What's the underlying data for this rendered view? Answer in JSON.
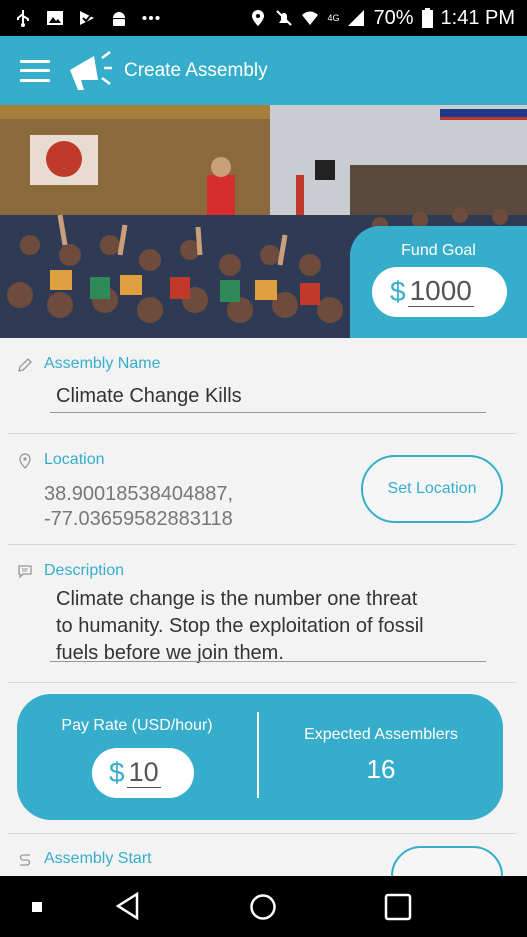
{
  "status_bar": {
    "network": "4G",
    "battery": "70%",
    "time": "1:41 PM"
  },
  "app_bar": {
    "title": "Create Assembly"
  },
  "fund_goal": {
    "label": "Fund Goal",
    "currency": "$",
    "value": "1000"
  },
  "assembly_name": {
    "label": "Assembly Name",
    "value": "Climate Change Kills"
  },
  "location": {
    "label": "Location",
    "coords_line1": "38.90018538404887,",
    "coords_line2": "-77.03659582883118",
    "button_label": "Set Location"
  },
  "description": {
    "label": "Description",
    "line1": "Climate change is the number one threat",
    "line2": "to humanity. Stop the exploitation of fossil",
    "line3": "fuels before we join them."
  },
  "pay": {
    "label": "Pay Rate (USD/hour)",
    "currency": "$",
    "value": "10",
    "expected_label": "Expected Assemblers",
    "expected_value": "16"
  },
  "assembly_start": {
    "label": "Assembly Start"
  },
  "colors": {
    "accent": "#36aecb",
    "status_bar": "#000000",
    "background": "#f3f3f3"
  },
  "icons": [
    "usb-icon",
    "image-icon",
    "check-flag-icon",
    "android-icon",
    "more-icon",
    "location-pin-icon",
    "mute-icon",
    "wifi-icon",
    "signal-icon",
    "battery-icon",
    "menu-icon",
    "megaphone-icon",
    "pencil-icon",
    "map-pin-icon",
    "chat-icon",
    "route-icon",
    "back-icon",
    "home-icon",
    "recents-icon"
  ]
}
